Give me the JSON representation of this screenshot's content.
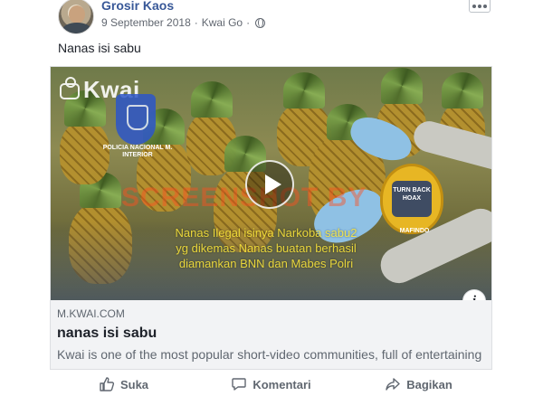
{
  "post": {
    "author": "Grosir Kaos",
    "date": "9 September 2018",
    "separator": "·",
    "app": "Kwai Go",
    "privacy_icon": "globe-icon",
    "caption": "Nanas isi sabu"
  },
  "video": {
    "logo_text": "Kwai",
    "badge_text": "POLICIA NACIONAL M. INTERIOR",
    "watermark": "SCREENSHOT BY",
    "stamp_top": "TURN BACK HOAX",
    "stamp_bottom": "MAFINDO",
    "overlay_line_1": "Nanas Ilegal isinya Narkoba sabu2",
    "overlay_line_2": "yg dikemas Nanas buatan berhasil",
    "overlay_line_3": "diamankan BNN dan  Mabes Polri"
  },
  "link": {
    "domain": "M.KWAI.COM",
    "title": "nanas isi sabu",
    "description": "Kwai is one of the most popular short-video communities, full of entertaining"
  },
  "actions": {
    "like": "Suka",
    "comment": "Komentari",
    "share": "Bagikan"
  },
  "colors": {
    "author": "#385898",
    "card_background": "#f2f3f5",
    "muted_text": "#606770"
  }
}
